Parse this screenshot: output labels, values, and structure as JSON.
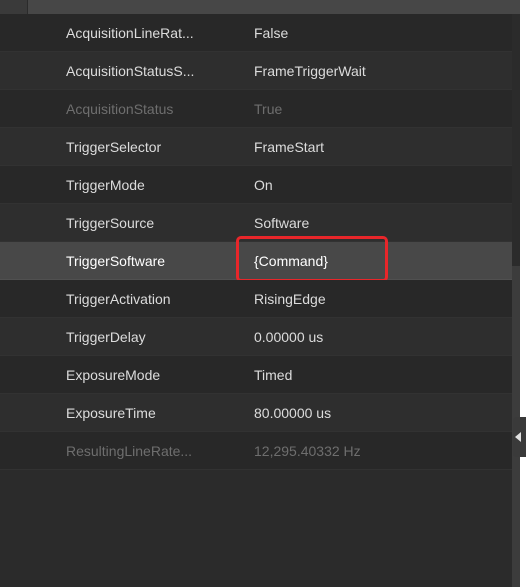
{
  "properties": [
    {
      "name": "AcquisitionLineRat...",
      "value": "False",
      "state": "normal"
    },
    {
      "name": "AcquisitionStatusS...",
      "value": "FrameTriggerWait",
      "state": "normal"
    },
    {
      "name": "AcquisitionStatus",
      "value": "True",
      "state": "disabled"
    },
    {
      "name": "TriggerSelector",
      "value": "FrameStart",
      "state": "normal"
    },
    {
      "name": "TriggerMode",
      "value": "On",
      "state": "normal"
    },
    {
      "name": "TriggerSource",
      "value": "Software",
      "state": "normal"
    },
    {
      "name": "TriggerSoftware",
      "value": "{Command}",
      "state": "selected"
    },
    {
      "name": "TriggerActivation",
      "value": "RisingEdge",
      "state": "normal"
    },
    {
      "name": "TriggerDelay",
      "value": "0.00000 us",
      "state": "normal"
    },
    {
      "name": "ExposureMode",
      "value": "Timed",
      "state": "normal"
    },
    {
      "name": "ExposureTime",
      "value": "80.00000 us",
      "state": "normal"
    },
    {
      "name": "ResultingLineRate...",
      "value": "12,295.40332 Hz",
      "state": "disabled"
    }
  ],
  "colors": {
    "panel_background": "#2b2b2b",
    "selected_row": "#484848",
    "highlight_border": "#e8262a",
    "text": "#dcdcdc",
    "disabled_text": "#6e6e6e"
  },
  "icons": {
    "side_handle": "chevron-left-icon"
  }
}
